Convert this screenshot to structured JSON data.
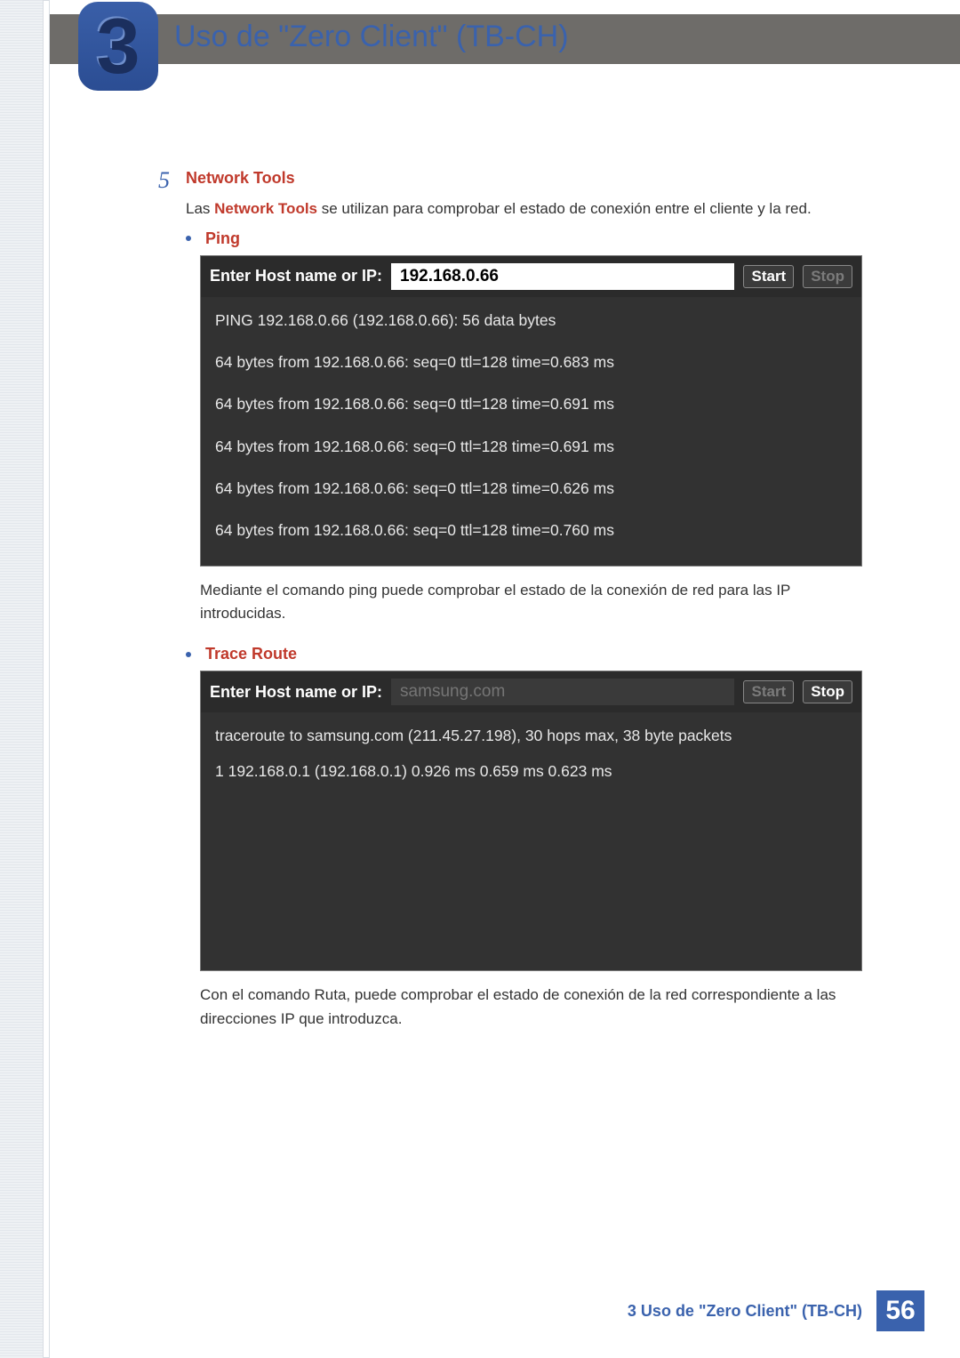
{
  "chapter_number": "3",
  "header_title": "Uso de \"Zero Client\" (TB-CH)",
  "step": {
    "number": "5",
    "title": "Network Tools",
    "description_before": "Las ",
    "description_keyword": "Network Tools",
    "description_after": " se utilizan para comprobar el estado de conexión entre el cliente y la red."
  },
  "ping": {
    "bullet_label": "Ping",
    "input_label": "Enter Host name or IP:",
    "input_value": "192.168.0.66",
    "start_label": "Start",
    "stop_label": "Stop",
    "output_lines": [
      "PING 192.168.0.66 (192.168.0.66): 56 data bytes",
      "64 bytes from 192.168.0.66: seq=0 ttl=128 time=0.683 ms",
      "64 bytes from 192.168.0.66: seq=0 ttl=128 time=0.691 ms",
      "64 bytes from 192.168.0.66: seq=0 ttl=128 time=0.691 ms",
      "64 bytes from 192.168.0.66: seq=0 ttl=128 time=0.626 ms",
      "64 bytes from 192.168.0.66: seq=0 ttl=128 time=0.760 ms"
    ],
    "post_text": "Mediante el comando ping puede comprobar el estado de la conexión de red para las IP introducidas."
  },
  "trace": {
    "bullet_label": "Trace Route",
    "input_label": "Enter Host name or IP:",
    "input_placeholder": "samsung.com",
    "start_label": "Start",
    "stop_label": "Stop",
    "output_lines": [
      "traceroute to samsung.com (211.45.27.198), 30 hops max, 38 byte packets",
      "1  192.168.0.1 (192.168.0.1)  0.926 ms  0.659 ms  0.623 ms"
    ],
    "post_text": "Con el comando Ruta, puede comprobar el estado de conexión de la red correspondiente a las direcciones IP que introduzca."
  },
  "footer": {
    "text": "3 Uso de \"Zero Client\" (TB-CH)",
    "page": "56"
  }
}
